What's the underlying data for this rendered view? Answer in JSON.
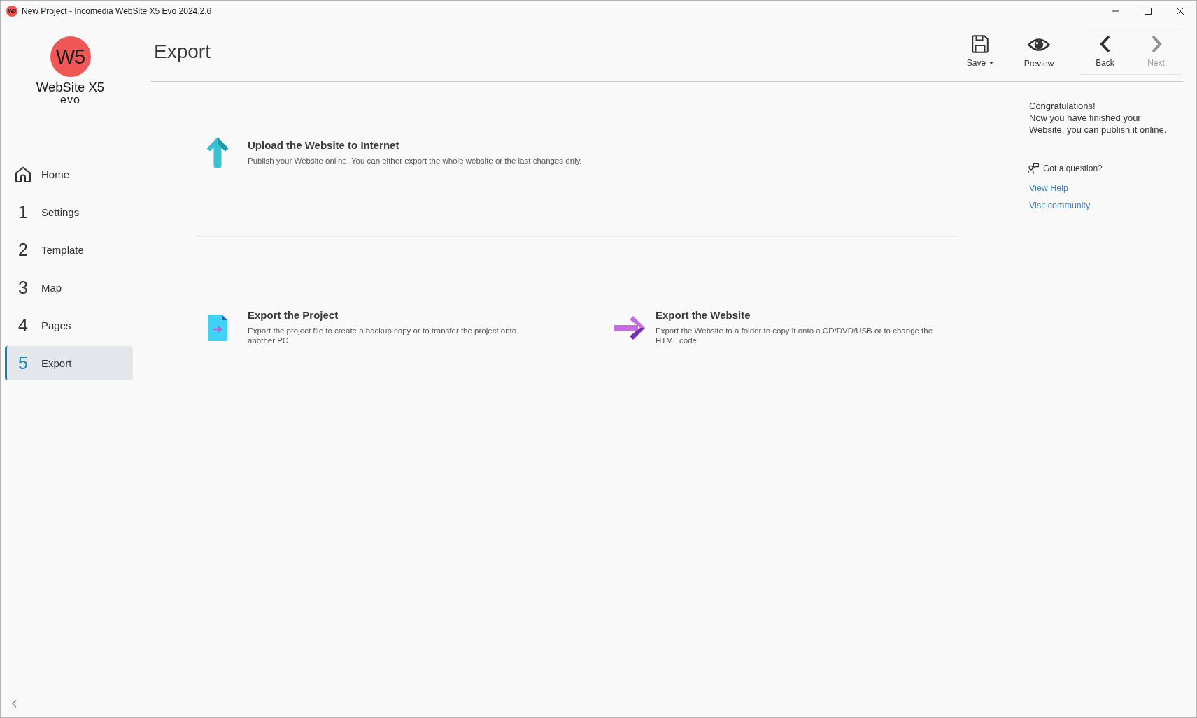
{
  "window": {
    "logo_mark": "W5",
    "title": "New Project - Incomedia WebSite X5 Evo 2024.2.6"
  },
  "logo": {
    "mark": "W5",
    "wordmark": "WebSite X5",
    "edition": "evo"
  },
  "sidebar": {
    "items": [
      {
        "kind": "home",
        "label": "Home",
        "selected": false
      },
      {
        "kind": "step",
        "number": "1",
        "label": "Settings",
        "selected": false
      },
      {
        "kind": "step",
        "number": "2",
        "label": "Template",
        "selected": false
      },
      {
        "kind": "step",
        "number": "3",
        "label": "Map",
        "selected": false
      },
      {
        "kind": "step",
        "number": "4",
        "label": "Pages",
        "selected": false
      },
      {
        "kind": "step",
        "number": "5",
        "label": "Export",
        "selected": true
      }
    ]
  },
  "header": {
    "title": "Export"
  },
  "toolbar": {
    "actions": [
      {
        "kind": "save",
        "label": "Save",
        "dropdown": true
      },
      {
        "kind": "preview",
        "label": "Preview",
        "dropdown": false
      }
    ],
    "navigation": [
      {
        "kind": "back",
        "label": "Back",
        "disabled": false
      },
      {
        "kind": "next",
        "label": "Next",
        "disabled": true
      }
    ]
  },
  "sections": [
    {
      "options": [
        {
          "kind": "upload",
          "title": "Upload the Website to Internet",
          "description": "Publish your Website online. You can either export the whole website or the last changes only."
        }
      ]
    },
    {
      "options": [
        {
          "kind": "project",
          "title": "Export the Project",
          "description": "Export the project file to create a backup copy or to transfer the project onto another PC."
        },
        {
          "kind": "website",
          "title": "Export the Website",
          "description": "Export the Website to a folder to copy it onto a CD/DVD/USB or to change the HTML code"
        }
      ]
    }
  ],
  "help": {
    "heading": "Congratulations!",
    "message": "Now you have finished your Website, you can publish it online.",
    "question": "Got a question?",
    "links": [
      "View Help",
      "Visit community"
    ]
  }
}
